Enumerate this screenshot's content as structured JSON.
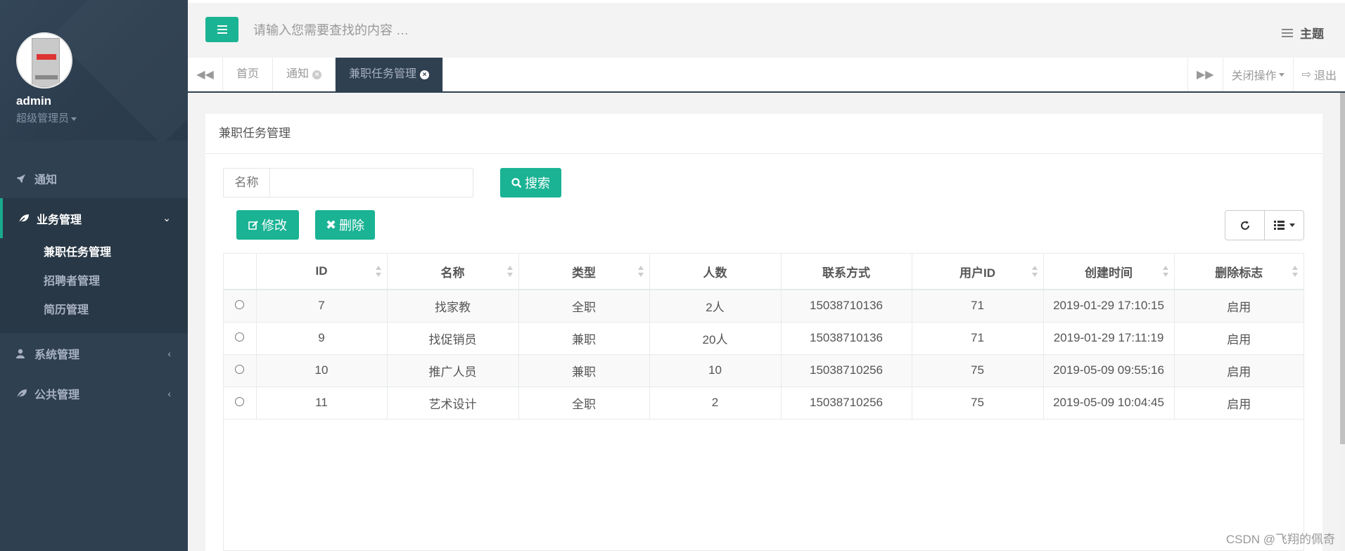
{
  "sidebar": {
    "username": "admin",
    "role": "超级管理员",
    "nav": [
      {
        "label": "通知",
        "icon": "rocket-icon"
      },
      {
        "label": "业务管理",
        "icon": "leaf-icon",
        "expanded": true,
        "children": [
          {
            "label": "兼职任务管理",
            "active": true
          },
          {
            "label": "招聘者管理"
          },
          {
            "label": "简历管理"
          }
        ]
      },
      {
        "label": "系统管理",
        "icon": "user-icon"
      },
      {
        "label": "公共管理",
        "icon": "leaf-icon"
      }
    ]
  },
  "topbar": {
    "search_placeholder": "请输入您需要查找的内容 …",
    "theme_label": "主题"
  },
  "tabs": {
    "items": [
      {
        "label": "首页"
      },
      {
        "label": "通知"
      },
      {
        "label": "兼职任务管理",
        "active": true
      }
    ],
    "close_ops": "关闭操作",
    "logout": "退出"
  },
  "panel": {
    "title": "兼职任务管理",
    "filter_label": "名称",
    "filter_value": "",
    "search_button": "搜索",
    "edit_button": "修改",
    "delete_button": "删除"
  },
  "table": {
    "columns": [
      "ID",
      "名称",
      "类型",
      "人数",
      "联系方式",
      "用户ID",
      "创建时间",
      "删除标志"
    ],
    "rows": [
      [
        "7",
        "找家教",
        "全职",
        "2人",
        "15038710136",
        "71",
        "2019-01-29 17:10:15",
        "启用"
      ],
      [
        "9",
        "找促销员",
        "兼职",
        "20人",
        "15038710136",
        "71",
        "2019-01-29 17:11:19",
        "启用"
      ],
      [
        "10",
        "推广人员",
        "兼职",
        "10",
        "15038710256",
        "75",
        "2019-05-09 09:55:16",
        "启用"
      ],
      [
        "11",
        "艺术设计",
        "全职",
        "2",
        "15038710256",
        "75",
        "2019-05-09 10:04:45",
        "启用"
      ]
    ]
  },
  "watermark": "CSDN @飞翔的佩奇",
  "colors": {
    "accent": "#1ab394",
    "sidebar": "#2f4050"
  }
}
